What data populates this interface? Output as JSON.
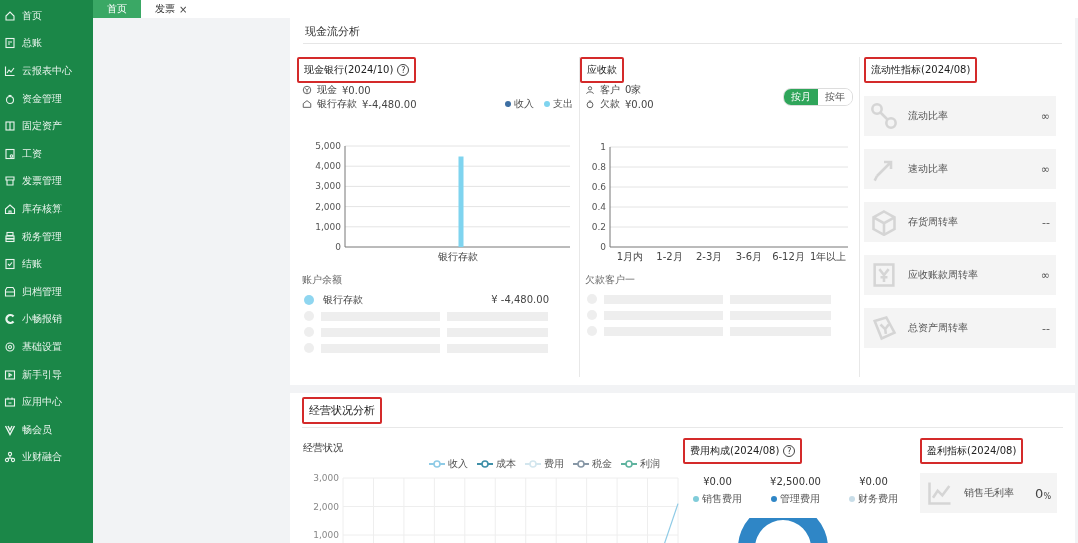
{
  "sidebar": {
    "items": [
      {
        "label": "首页"
      },
      {
        "label": "总账"
      },
      {
        "label": "云报表中心"
      },
      {
        "label": "资金管理"
      },
      {
        "label": "固定资产"
      },
      {
        "label": "工资"
      },
      {
        "label": "发票管理"
      },
      {
        "label": "库存核算"
      },
      {
        "label": "税务管理"
      },
      {
        "label": "结账"
      },
      {
        "label": "归档管理"
      },
      {
        "label": "小畅报销"
      },
      {
        "label": "基础设置"
      },
      {
        "label": "新手引导"
      },
      {
        "label": "应用中心"
      },
      {
        "label": "畅会员"
      },
      {
        "label": "业财融合"
      }
    ]
  },
  "tabs": [
    {
      "label": "首页",
      "selected": true
    },
    {
      "label": "发票",
      "selected": false,
      "close": "×"
    }
  ],
  "cash_flow": {
    "title": "现金流分析",
    "cash_bank": {
      "title": "现金银行(2024/10)",
      "highlighted": true,
      "help": "?",
      "lines": [
        {
          "label": "现金",
          "value": "¥0.00"
        },
        {
          "label": "银行存款",
          "value": "¥-4,480.00"
        }
      ],
      "chart_data": {
        "type": "bar",
        "categories": [
          "银行存款"
        ],
        "series": [
          {
            "name": "收入",
            "color": "#3d6fa3",
            "values": [
              0
            ]
          },
          {
            "name": "支出",
            "color": "#7fd4ef",
            "values": [
              4480
            ]
          }
        ],
        "ylim": [
          0,
          5000
        ],
        "yticks": [
          {
            "value": 0,
            "label": "0"
          },
          {
            "value": 1000,
            "label": "1,000"
          },
          {
            "value": 2000,
            "label": "2,000"
          },
          {
            "value": 3000,
            "label": "3,000"
          },
          {
            "value": 4000,
            "label": "4,000"
          },
          {
            "value": 5000,
            "label": "5,000"
          }
        ],
        "grid": true
      },
      "list_title": "账户余额",
      "accounts": [
        {
          "name": "银行存款",
          "amount": "¥ -4,480.00",
          "color": "#8fd6f0"
        }
      ],
      "loading_rows": [
        {
          "kind": "skeleton"
        },
        {
          "kind": "skeleton"
        },
        {
          "kind": "skeleton"
        }
      ]
    },
    "receivables": {
      "title": "应收款",
      "highlighted": true,
      "lines": [
        {
          "label": "客户",
          "value": "0家"
        },
        {
          "label": "欠款",
          "value": "¥0.00"
        }
      ],
      "toggle": [
        {
          "label": "按月",
          "selected": true
        },
        {
          "label": "按年",
          "selected": false
        }
      ],
      "chart_data": {
        "type": "bar",
        "categories": [
          "1月内",
          "1-2月",
          "2-3月",
          "3-6月",
          "6-12月",
          "1年以上"
        ],
        "values": [
          0,
          0,
          0,
          0,
          0,
          0
        ],
        "ylim": [
          0,
          1
        ],
        "yticks": [
          0,
          0.2,
          0.4,
          0.6,
          0.8,
          1
        ],
        "grid": true
      },
      "list_title": "欠款客户一",
      "loading_rows": [
        {
          "kind": "skeleton"
        },
        {
          "kind": "skeleton"
        },
        {
          "kind": "skeleton"
        }
      ]
    },
    "liquidity": {
      "title": "流动性指标(2024/08)",
      "highlighted": true,
      "items": [
        {
          "label": "流动比率",
          "value": "∞"
        },
        {
          "label": "速动比率",
          "value": "∞"
        },
        {
          "label": "存货周转率",
          "value": "--"
        },
        {
          "label": "应收账款周转率",
          "value": "∞"
        },
        {
          "label": "总资产周转率",
          "value": "--"
        }
      ]
    }
  },
  "operations": {
    "title": "经营状况分析",
    "highlighted": true,
    "status": {
      "title": "经营状况",
      "legend": [
        {
          "name": "收入",
          "color": "#8fcbe6"
        },
        {
          "name": "成本",
          "color": "#3f8fa8"
        },
        {
          "name": "费用",
          "color": "#d3e6ee"
        },
        {
          "name": "税金",
          "color": "#8797a6"
        },
        {
          "name": "利润",
          "color": "#5fb39f"
        }
      ],
      "y_labels": [
        "3,000",
        "2,000",
        "1,000"
      ]
    },
    "expenses": {
      "title": "费用构成(2024/08)",
      "highlighted": true,
      "help": "?",
      "items": [
        {
          "amount": "¥0.00",
          "label": "销售费用",
          "color": "#80ccd9"
        },
        {
          "amount": "¥2,500.00",
          "label": "管理费用",
          "color": "#2f86c6"
        },
        {
          "amount": "¥0.00",
          "label": "财务费用",
          "color": "#c8dde8"
        }
      ]
    },
    "profit": {
      "title": "盈利指标(2024/08)",
      "highlighted": true,
      "items": [
        {
          "label": "销售毛利率",
          "value": "0$_{%}$"
        }
      ]
    }
  }
}
